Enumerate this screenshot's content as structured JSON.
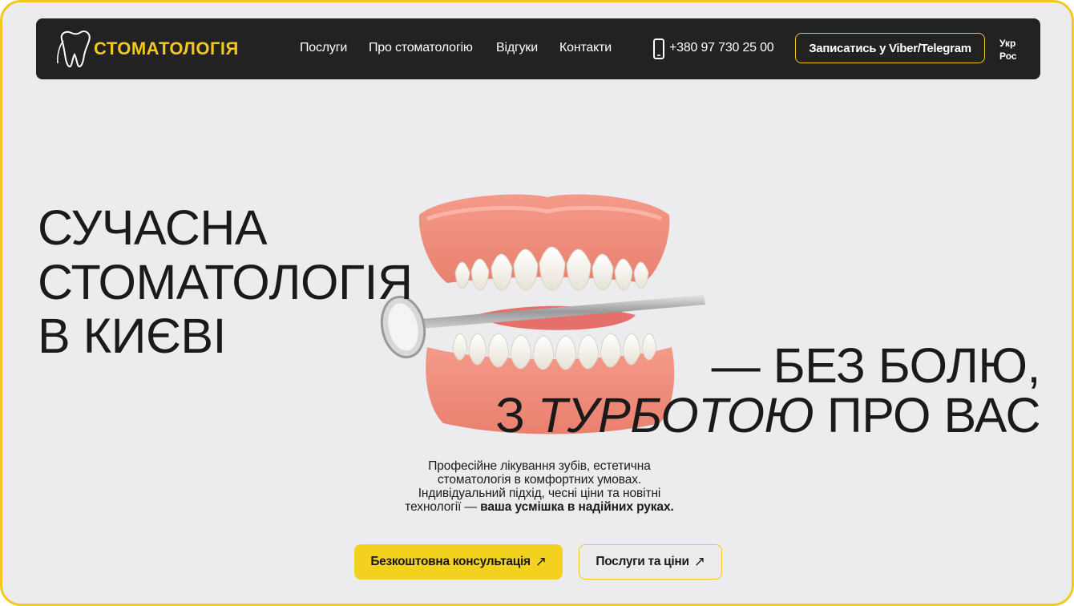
{
  "header": {
    "logo_text": "СТОМАТОЛОГІЯ",
    "menu": [
      {
        "label": "Послуги"
      },
      {
        "label": "Про стоматологію"
      },
      {
        "label": "Відгуки"
      },
      {
        "label": "Контакти"
      }
    ],
    "phone": "+380 97 730 25 00",
    "book_button": "Записатись у Viber/Telegram",
    "languages": [
      "Укр",
      "Рос"
    ]
  },
  "hero": {
    "title_lines": [
      "СУЧАСНА",
      "СТОМАТОЛОГІЯ",
      "В КИЄВІ"
    ],
    "subtitle_line1": "— БЕЗ БОЛЮ,",
    "subtitle_line2_prefix": "З ",
    "subtitle_line2_italic": "ТУРБОТОЮ",
    "subtitle_line2_suffix": " ПРО ВАС",
    "description_lines": [
      "Професійне лікування зубів, естетична",
      "стоматологія в комфортних умовах.",
      "Індивідуальний підхід, чесні ціни та новітні"
    ],
    "description_last_prefix": "технології — ",
    "description_last_bold": "ваша усмішка в надійних руках.",
    "cta_primary": "Безкоштовна консультація",
    "cta_secondary": "Послуги та ціни",
    "cta_arrow": "↗"
  },
  "colors": {
    "accent": "#f2c81f",
    "header_bg": "#222222",
    "page_bg": "#ececee",
    "text": "#1a1a1a"
  },
  "icons": [
    "tooth-logo-icon",
    "phone-icon",
    "arrow-up-right-icon"
  ]
}
